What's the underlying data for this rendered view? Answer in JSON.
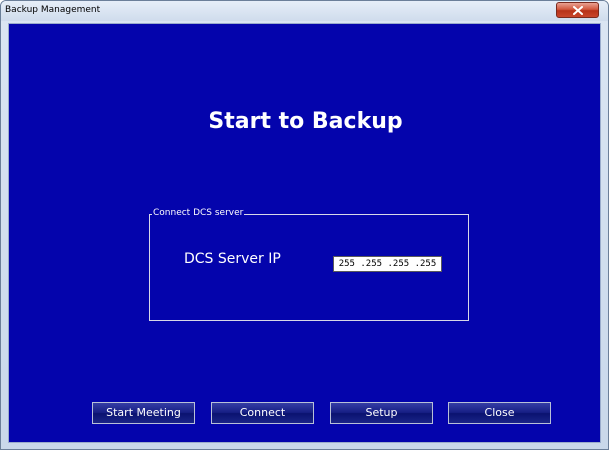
{
  "window": {
    "title": "Backup Management",
    "close_icon": "close-icon"
  },
  "main": {
    "heading": "Start to Backup",
    "background_color": "#0404ac"
  },
  "connect_group": {
    "legend": "Connect DCS server",
    "ip_label": "DCS Server IP",
    "ip_value": "255 .255 .255 .255"
  },
  "buttons": {
    "start_meeting": "Start Meeting",
    "connect": "Connect",
    "setup": "Setup",
    "close": "Close"
  }
}
